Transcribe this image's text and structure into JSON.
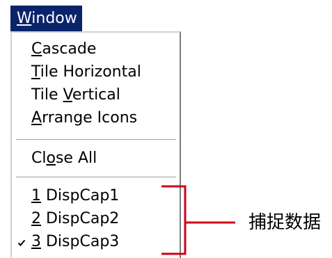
{
  "menu": {
    "title": "Window",
    "title_mnemonic": "W",
    "title_rest": "indow",
    "items": [
      {
        "mn_pre": "",
        "mn": "C",
        "mn_post": "ascade"
      },
      {
        "mn_pre": "",
        "mn": "T",
        "mn_post": "ile Horizontal"
      },
      {
        "mn_pre": "Tile ",
        "mn": "V",
        "mn_post": "ertical"
      },
      {
        "mn_pre": "",
        "mn": "A",
        "mn_post": "rrange Icons"
      },
      {
        "mn_pre": "Cl",
        "mn": "o",
        "mn_post": "se All"
      }
    ],
    "windows": [
      {
        "num": "1",
        "name": " DispCap1",
        "checked": false
      },
      {
        "num": "2",
        "name": " DispCap2",
        "checked": false
      },
      {
        "num": "3",
        "name": " DispCap3",
        "checked": true
      }
    ]
  },
  "annotation": {
    "label": "捕捉数据",
    "color": "#d0021b"
  },
  "icons": {
    "check": "checkmark-icon"
  }
}
